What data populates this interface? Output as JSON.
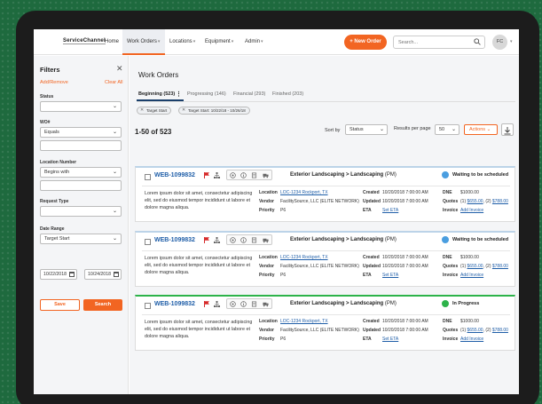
{
  "app": {
    "logo_text": "ServiceChannel",
    "nav": [
      {
        "label": "Home"
      },
      {
        "label": "Work Orders"
      },
      {
        "label": "Locations"
      },
      {
        "label": "Equipment"
      },
      {
        "label": "Admin"
      }
    ],
    "new_order_label": "+ New Order",
    "search_placeholder": "Search...",
    "avatar_initials": "FC"
  },
  "filters": {
    "title": "Filters",
    "add_remove": "Add/Remove",
    "clear_all": "Clear All",
    "status_label": "Status",
    "status_value": "",
    "wo_label": "WO#",
    "wo_operator": "Equals",
    "location_label": "Location Number",
    "location_operator": "Begins with",
    "request_type_label": "Request Type",
    "request_type_value": "",
    "date_range_label": "Date Range",
    "date_field": "Target Start",
    "date_from": "10/22/2018",
    "date_to": "10/24/2018",
    "save_label": "Save",
    "search_label": "Search"
  },
  "main": {
    "title": "Work Orders",
    "tabs": [
      {
        "label": "Beginning (523)"
      },
      {
        "label": "Progressing (146)"
      },
      {
        "label": "Financial (293)"
      },
      {
        "label": "Finished (203)"
      }
    ],
    "chips": [
      {
        "label": "Target Start"
      },
      {
        "label": "Target Start: 10/22/18 - 10/26/18"
      }
    ],
    "count": "1-50 of 523",
    "sort_label": "Sort by",
    "sort_value": "Status",
    "per_page_label": "Results per page",
    "per_page_value": "50",
    "actions_label": "Actions"
  },
  "labels": {
    "location": "Location",
    "vendor": "Vendor",
    "priority": "Priority",
    "created": "Created",
    "updated": "Updated",
    "eta": "ETA",
    "dne": "DNE",
    "quotes": "Quotes",
    "invoice": "Invoice"
  },
  "work_orders": [
    {
      "id": "WEB-1099832",
      "trade": "Exterior Landscaping > Landscaping",
      "trade_suffix": "(PM)",
      "status": "Waiting to be scheduled",
      "status_color": "#4a9ee0",
      "description": "Lorem ipsum dolor sit amet, consectetur adipiscing elit, sed do eiusmod tempor incididunt ut labore et dolore magna aliqua.",
      "location": "LOC-1234 Rockport, TX",
      "vendor": "FacilitySource, LLC (ELITE NETWORK)",
      "priority": "P6",
      "created": "10/20/2018 7:00:00 AM",
      "updated": "10/20/2018 7:00:00 AM",
      "eta": "Set ETA",
      "dne": "$1000.00",
      "quote1_prefix": "(1)",
      "quote1": "$655.00",
      "quote2_prefix": ", (2)",
      "quote2": "$788.00",
      "invoice": "Add Invoice"
    },
    {
      "id": "WEB-1099832",
      "trade": "Exterior Landscaping > Landscaping",
      "trade_suffix": "(PM)",
      "status": "Waiting to be scheduled",
      "status_color": "#4a9ee0",
      "description": "Lorem ipsum dolor sit amet, consectetur adipiscing elit, sed do eiusmod tempor incididunt ut labore et dolore magna aliqua.",
      "location": "LOC-1234 Rockport, TX",
      "vendor": "FacilitySource, LLC (ELITE NETWORK)",
      "priority": "P6",
      "created": "10/20/2018 7:00:00 AM",
      "updated": "10/20/2018 7:00:00 AM",
      "eta": "Set ETA",
      "dne": "$1000.00",
      "quote1_prefix": "(1)",
      "quote1": "$655.00",
      "quote2_prefix": ", (2)",
      "quote2": "$788.00",
      "invoice": "Add Invoice"
    },
    {
      "id": "WEB-1099832",
      "trade": "Exterior Landscaping > Landscaping",
      "trade_suffix": "(PM)",
      "status": "In Progress",
      "status_color": "#2db34a",
      "description": "Lorem ipsum dolor sit amet, consectetur adipiscing elit, sed do eiusmod tempor incididunt ut labore et dolore magna aliqua.",
      "location": "LOC-1234 Rockport, TX",
      "vendor": "FacilitySource, LLC (ELITE NETWORK)",
      "priority": "P6",
      "created": "10/20/2018 7:00:00 AM",
      "updated": "10/20/2018 7:00:00 AM",
      "eta": "Set ETA",
      "dne": "$1000.00",
      "quote1_prefix": "(1)",
      "quote1": "$655.00",
      "quote2_prefix": ", (2)",
      "quote2": "$788.00",
      "invoice": "Add Invoice"
    }
  ]
}
